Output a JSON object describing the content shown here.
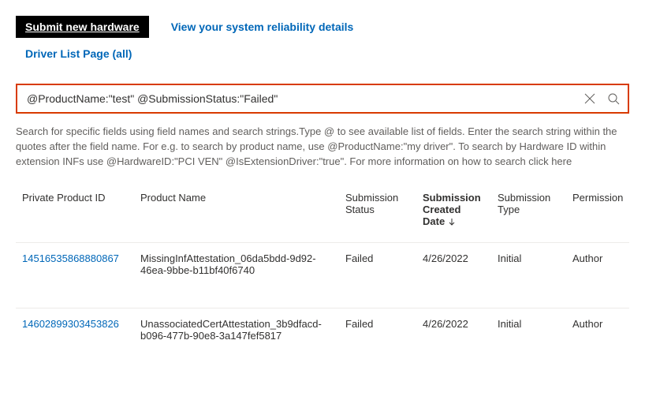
{
  "header": {
    "submit_btn": "Submit new hardware",
    "reliability_link": "View your system reliability details",
    "driver_list_link": "Driver List Page (all)"
  },
  "search": {
    "value": "@ProductName:\"test\" @SubmissionStatus:\"Failed\""
  },
  "help": {
    "text_main": "Search for specific fields using field names and search strings.Type @ to see available list of fields. Enter the search string within the quotes after the field name. For e.g. to search by product name, use @ProductName:\"my driver\". To search by Hardware ID within extension INFs use @HardwareID:\"PCI VEN\" @IsExtensionDriver:\"true\". For more information on how to search click ",
    "here": "here"
  },
  "columns": {
    "id": "Private Product ID",
    "name": "Product Name",
    "status": "Submission Status",
    "date": "Submission Created Date",
    "type": "Submission Type",
    "perm": "Permission"
  },
  "rows": [
    {
      "id": "14516535868880867",
      "name": "MissingInfAttestation_06da5bdd-9d92-46ea-9bbe-b11bf40f6740",
      "status": "Failed",
      "date": "4/26/2022",
      "type": "Initial",
      "perm": "Author"
    },
    {
      "id": "14602899303453826",
      "name": "UnassociatedCertAttestation_3b9dfacd-b096-477b-90e8-3a147fef5817",
      "status": "Failed",
      "date": "4/26/2022",
      "type": "Initial",
      "perm": "Author"
    }
  ]
}
